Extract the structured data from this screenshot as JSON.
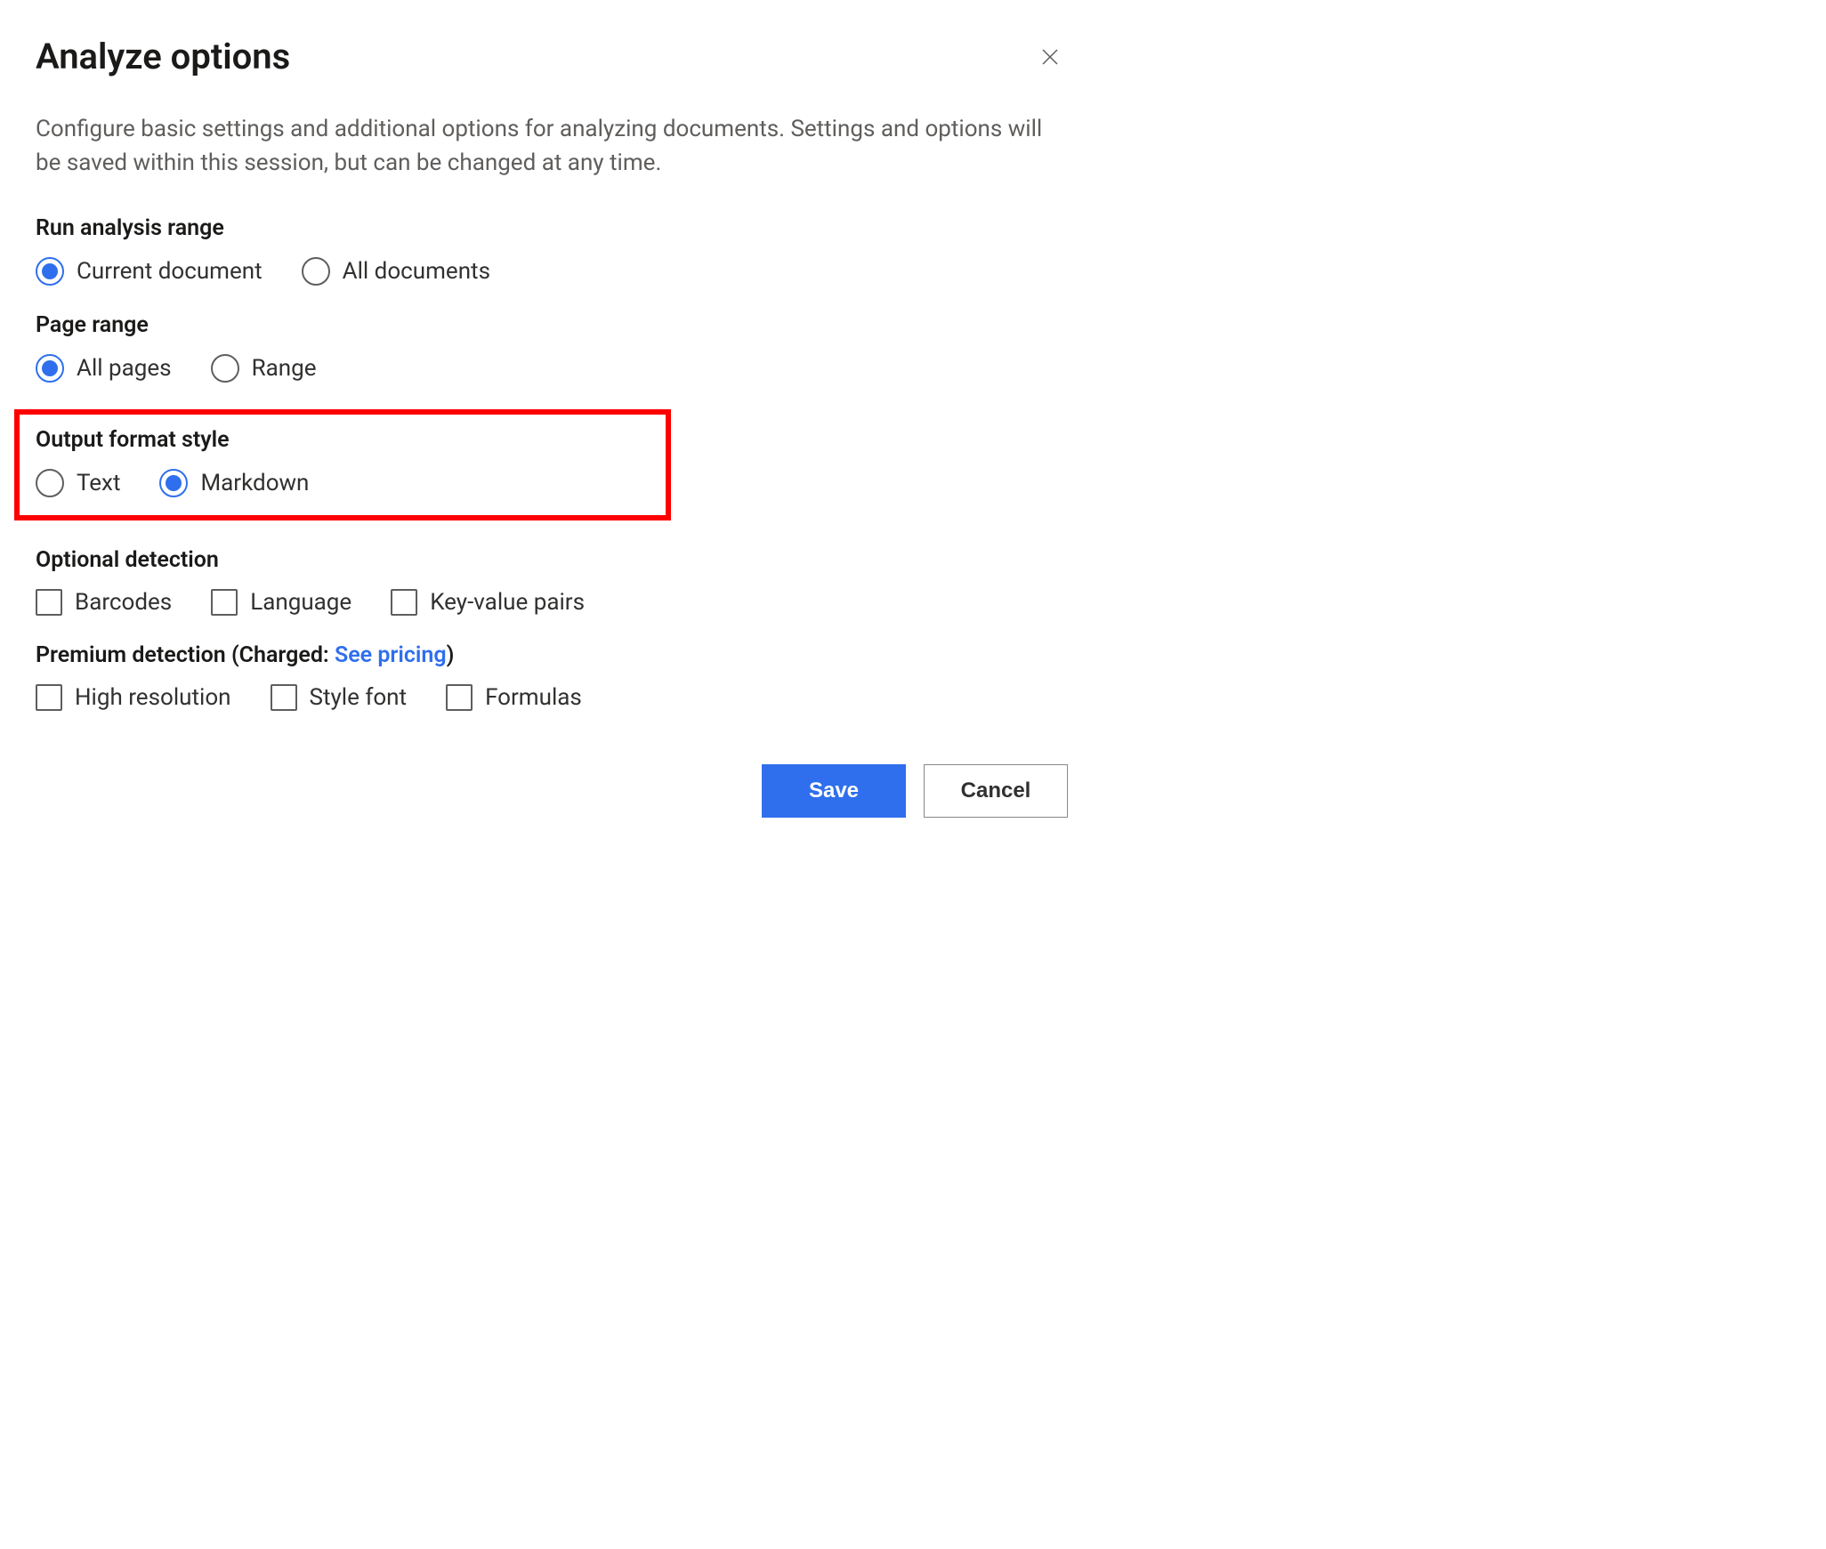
{
  "dialog": {
    "title": "Analyze options",
    "description": "Configure basic settings and additional options for analyzing documents. Settings and options will be saved within this session, but can be changed at any time."
  },
  "sections": {
    "run_range": {
      "title": "Run analysis range",
      "options": [
        {
          "label": "Current document",
          "selected": true
        },
        {
          "label": "All documents",
          "selected": false
        }
      ]
    },
    "page_range": {
      "title": "Page range",
      "options": [
        {
          "label": "All pages",
          "selected": true
        },
        {
          "label": "Range",
          "selected": false
        }
      ]
    },
    "output_format": {
      "title": "Output format style",
      "options": [
        {
          "label": "Text",
          "selected": false
        },
        {
          "label": "Markdown",
          "selected": true
        }
      ]
    },
    "optional_detection": {
      "title": "Optional detection",
      "options": [
        {
          "label": "Barcodes",
          "checked": false
        },
        {
          "label": "Language",
          "checked": false
        },
        {
          "label": "Key-value pairs",
          "checked": false
        }
      ]
    },
    "premium_detection": {
      "title_prefix": "Premium detection (Charged: ",
      "link_text": "See pricing",
      "title_suffix": ")",
      "options": [
        {
          "label": "High resolution",
          "checked": false
        },
        {
          "label": "Style font",
          "checked": false
        },
        {
          "label": "Formulas",
          "checked": false
        }
      ]
    }
  },
  "footer": {
    "save": "Save",
    "cancel": "Cancel"
  }
}
